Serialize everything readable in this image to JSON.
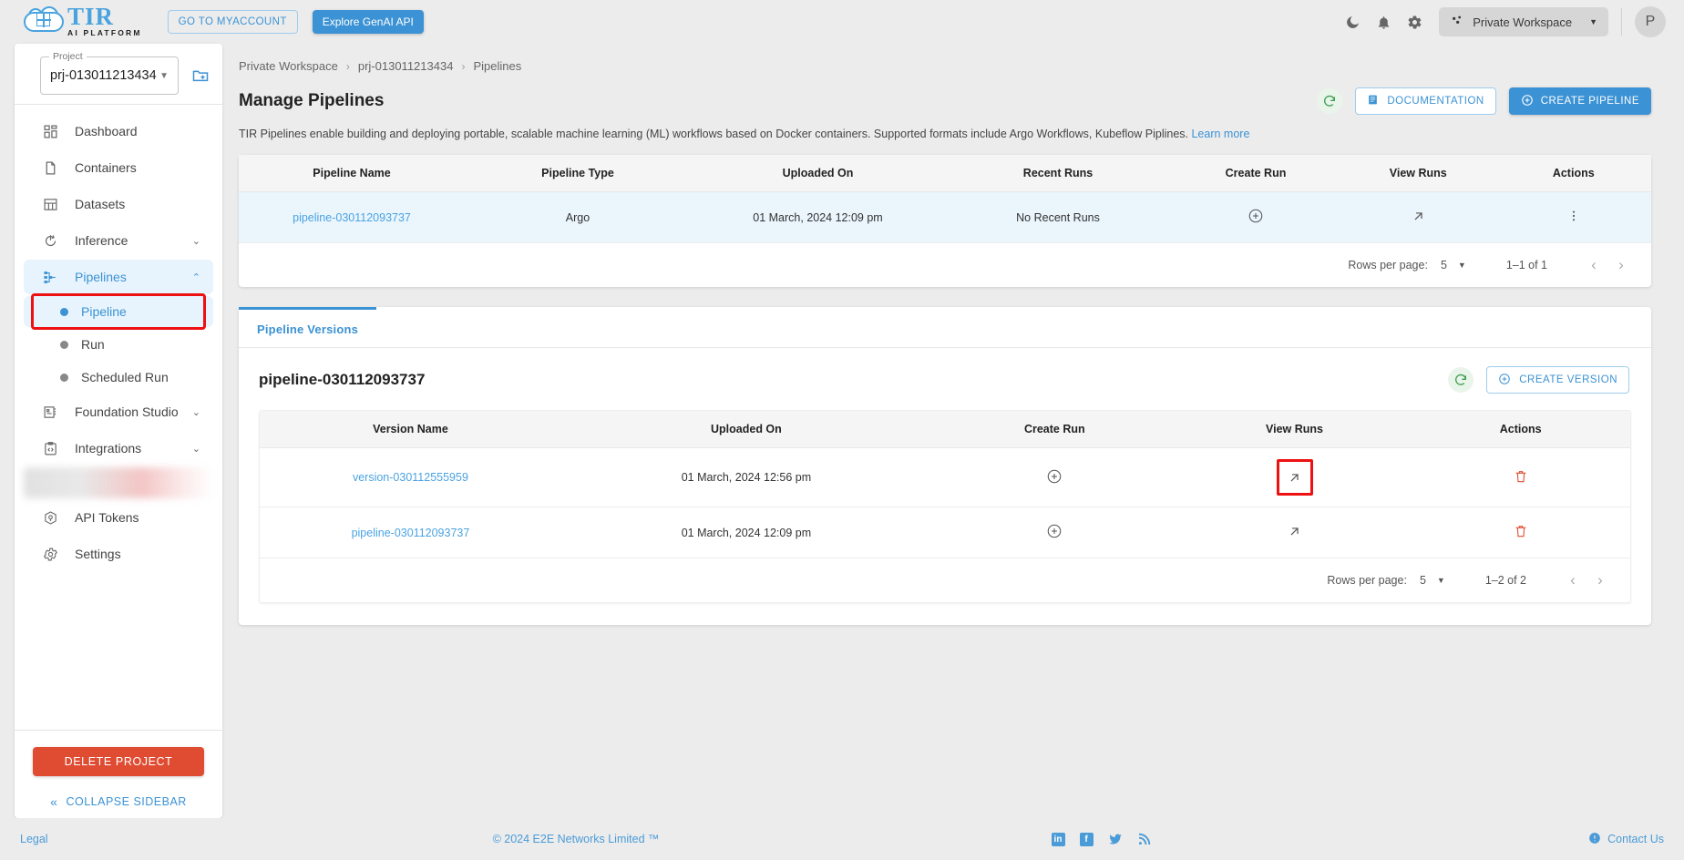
{
  "topbar": {
    "logo_main": "TIR",
    "logo_sub": "AI PLATFORM",
    "myaccount_label": "GO TO MYACCOUNT",
    "genai_label": "Explore GenAI API",
    "icons": [
      "dark-mode-icon",
      "notifications-icon",
      "settings-icon"
    ],
    "workspace": "Private Workspace",
    "avatar_initial": "P"
  },
  "sidebar": {
    "project_label": "Project",
    "project_value": "prj-013011213434",
    "items": [
      {
        "label": "Dashboard",
        "icon": "dashboard-icon",
        "expandable": false
      },
      {
        "label": "Containers",
        "icon": "containers-icon",
        "expandable": false
      },
      {
        "label": "Datasets",
        "icon": "datasets-icon",
        "expandable": false
      },
      {
        "label": "Inference",
        "icon": "inference-icon",
        "expandable": true
      },
      {
        "label": "Pipelines",
        "icon": "pipelines-icon",
        "expandable": true,
        "active": true
      },
      {
        "label": "Foundation Studio",
        "icon": "foundation-studio-icon",
        "expandable": true
      },
      {
        "label": "Integrations",
        "icon": "integrations-icon",
        "expandable": true
      },
      {
        "label": "API Tokens",
        "icon": "api-tokens-icon",
        "expandable": false
      },
      {
        "label": "Settings",
        "icon": "settings-icon",
        "expandable": false
      }
    ],
    "sub_items": [
      {
        "label": "Pipeline",
        "selected": true,
        "highlighted": true
      },
      {
        "label": "Run",
        "selected": false
      },
      {
        "label": "Scheduled Run",
        "selected": false
      }
    ],
    "delete_project_label": "DELETE PROJECT",
    "collapse_label": "COLLAPSE SIDEBAR"
  },
  "breadcrumb": [
    "Private Workspace",
    "prj-013011213434",
    "Pipelines"
  ],
  "page": {
    "title": "Manage Pipelines",
    "refresh_icon": "refresh-icon",
    "documentation_label": "DOCUMENTATION",
    "create_pipeline_label": "CREATE PIPELINE",
    "description": "TIR Pipelines enable building and deploying portable, scalable machine learning (ML) workflows based on Docker containers. Supported formats include Argo Workflows, Kubeflow Piplines.",
    "learn_more": "Learn more"
  },
  "pipelines_table": {
    "columns": [
      "Pipeline Name",
      "Pipeline Type",
      "Uploaded On",
      "Recent Runs",
      "Create Run",
      "View Runs",
      "Actions"
    ],
    "rows": [
      {
        "name": "pipeline-030112093737",
        "type": "Argo",
        "uploaded_on": "01 March, 2024 12:09 pm",
        "recent_runs": "No Recent Runs",
        "create_run_icon": "plus-circle-icon",
        "view_runs_icon": "arrow-up-right-icon",
        "actions_icon": "more-vertical-icon"
      }
    ],
    "pager": {
      "rows_per_page_label": "Rows per page:",
      "rows_per_page_value": "5",
      "range": "1–1 of 1",
      "prev_icon": "chevron-left-icon",
      "next_icon": "chevron-right-icon"
    }
  },
  "versions_section": {
    "tab_label": "Pipeline Versions",
    "title": "pipeline-030112093737",
    "refresh_icon": "refresh-icon",
    "create_version_label": "CREATE VERSION",
    "columns": [
      "Version Name",
      "Uploaded On",
      "Create Run",
      "View Runs",
      "Actions"
    ],
    "rows": [
      {
        "name": "version-030112555959",
        "uploaded_on": "01 March, 2024 12:56 pm",
        "create_run_icon": "plus-circle-icon",
        "view_runs_icon": "arrow-up-right-icon",
        "view_runs_highlighted": true,
        "actions_icon": "trash-icon"
      },
      {
        "name": "pipeline-030112093737",
        "uploaded_on": "01 March, 2024 12:09 pm",
        "create_run_icon": "plus-circle-icon",
        "view_runs_icon": "arrow-up-right-icon",
        "view_runs_highlighted": false,
        "actions_icon": "trash-icon"
      }
    ],
    "pager": {
      "rows_per_page_label": "Rows per page:",
      "rows_per_page_value": "5",
      "range": "1–2 of 2",
      "prev_icon": "chevron-left-icon",
      "next_icon": "chevron-right-icon"
    }
  },
  "footer": {
    "legal": "Legal",
    "copyright": "© 2024 E2E Networks Limited ™",
    "social": [
      "linkedin-icon",
      "facebook-icon",
      "twitter-icon",
      "rss-icon"
    ],
    "contact": "Contact Us"
  },
  "colors": {
    "accent": "#3b92d4",
    "danger": "#df4c32",
    "highlight": "#ee1111",
    "row_highlight": "#eaf5fc"
  }
}
